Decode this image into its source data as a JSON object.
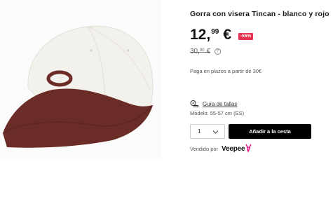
{
  "product": {
    "title": "Gorra con visera Tincan - blanco y rojo",
    "image_alt": "Gorra con visera Tincan blanco y rojo"
  },
  "price": {
    "current_int": "12,",
    "current_dec": "99",
    "currency": "€",
    "discount": "-56%",
    "old_int": "30,",
    "old_dec": "00",
    "old_currency": "€",
    "info_icon_glyph": "?"
  },
  "installments": {
    "text": "Paga en plazos a partir de 30€"
  },
  "size_guide": {
    "label": "Guía de tallas",
    "icon": "tape-measure-icon"
  },
  "model": {
    "text": "Modelo: 55-57 cm (ES)"
  },
  "quantity": {
    "value": "1",
    "icon": "chevron-down-icon"
  },
  "cart": {
    "button_label": "Añadir a la cesta"
  },
  "seller": {
    "label": "Vendido por",
    "brand": "Veepee",
    "brand_color": "#e6007e"
  },
  "colors": {
    "cap_crown": "#f3f1ec",
    "cap_brim": "#6b2b26",
    "discount_badge": "#e5344f"
  }
}
